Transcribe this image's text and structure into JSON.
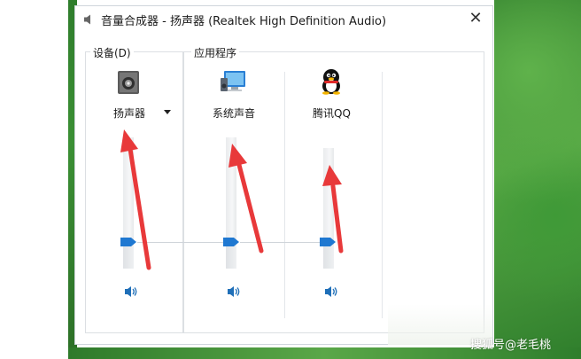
{
  "window": {
    "title": "音量合成器 - 扬声器 (Realtek High Definition Audio)",
    "close_label": "✕"
  },
  "device_group": {
    "label": "设备(D)",
    "device_name": "扬声器",
    "dropdown_icon": "triangle-down",
    "volume": 0.2
  },
  "apps_group": {
    "label": "应用程序",
    "apps": [
      {
        "name": "系统声音",
        "icon": "system-sounds-icon",
        "volume": 0.2
      },
      {
        "name": "腾讯QQ",
        "icon": "qq-penguin-icon",
        "volume": 0.2
      }
    ]
  },
  "annotations": {
    "arrow_color": "#e8393a"
  },
  "watermark": "搜狐号@老毛桃",
  "colors": {
    "thumb": "#1f78d1",
    "speaker_icon": "#1f6fb8"
  }
}
